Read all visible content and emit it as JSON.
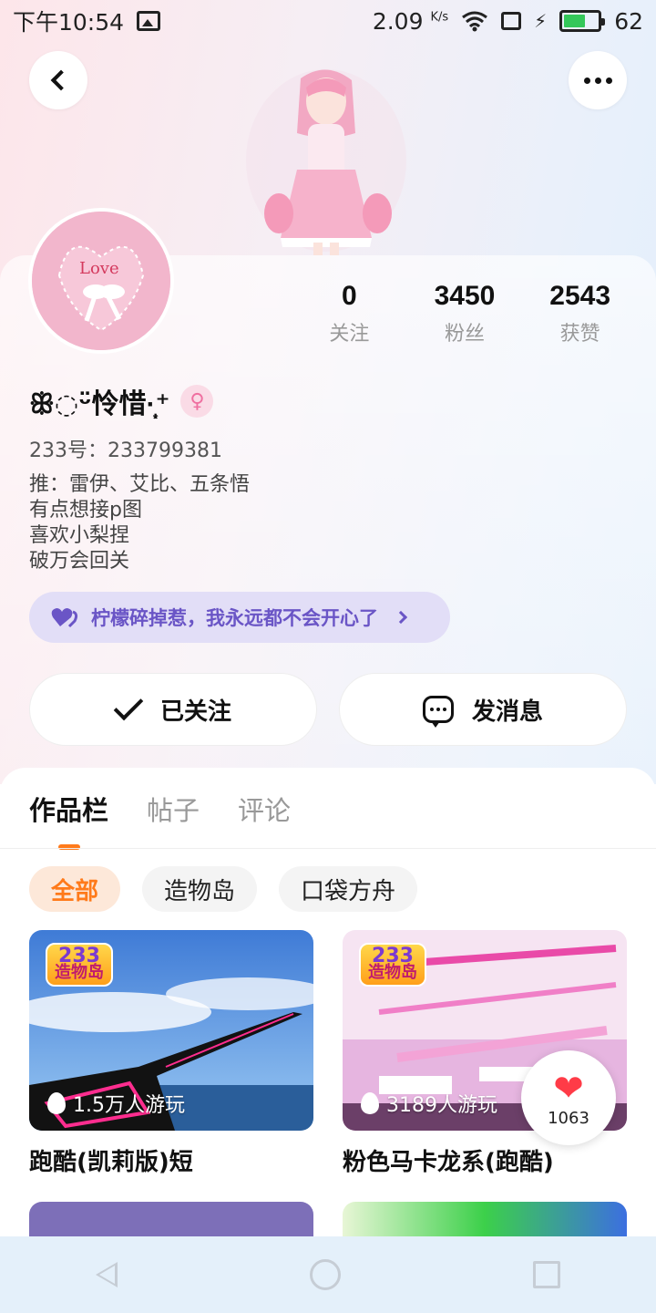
{
  "status_bar": {
    "time": "下午10:54",
    "net_speed": "2.09",
    "net_unit": "K/s",
    "battery": "62",
    "battery_level": 0.62
  },
  "profile": {
    "stats": [
      {
        "value": "0",
        "label": "关注"
      },
      {
        "value": "3450",
        "label": "粉丝"
      },
      {
        "value": "2543",
        "label": "获赞"
      }
    ],
    "username": "ꕥ◌ᵕ̈怜惜⁠·̩̩͙⁺",
    "gender_symbol": "♀",
    "user_id": "233号：233799381",
    "bio_lines": [
      "推：雷伊、艾比、五条悟",
      "有点想接p图",
      "喜欢小梨捏",
      "破万会回关"
    ],
    "banner_text": "柠檬碎掉惹，我永远都不会开心了"
  },
  "actions": {
    "follow_label": "已关注",
    "message_label": "发消息"
  },
  "tabs": [
    {
      "label": "作品栏",
      "active": true
    },
    {
      "label": "帖子",
      "active": false
    },
    {
      "label": "评论",
      "active": false
    }
  ],
  "filters": [
    {
      "label": "全部",
      "active": true
    },
    {
      "label": "造物岛",
      "active": false
    },
    {
      "label": "口袋方舟",
      "active": false
    }
  ],
  "cards": [
    {
      "badge_top": "233",
      "badge_bottom": "造物岛",
      "plays": "1.5万人游玩",
      "title": "跑酷(凯莉版)短"
    },
    {
      "badge_top": "233",
      "badge_bottom": "造物岛",
      "plays": "3189人游玩",
      "title": "粉色马卡龙系(跑酷)"
    }
  ],
  "like_bubble": {
    "count": "1063"
  },
  "colors": {
    "accent": "#ff7a1a",
    "banner_text": "#6a55c6",
    "like": "#ff3b47"
  }
}
